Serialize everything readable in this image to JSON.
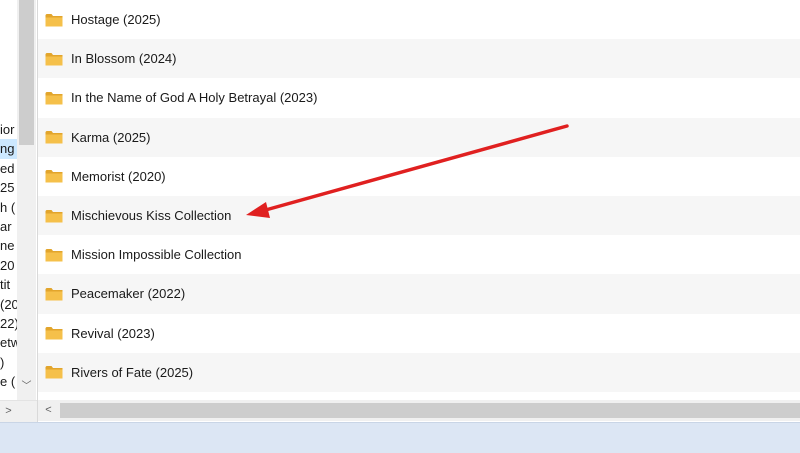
{
  "left_pane": {
    "fragments": [
      "ior",
      "ng",
      "ed",
      "25",
      "h (",
      "ar",
      "ne",
      "20",
      "tit",
      "(20",
      "22)",
      "etw",
      ")",
      "e ("
    ],
    "selected_index": 1
  },
  "folders": [
    {
      "label": "Hostage (2025)"
    },
    {
      "label": "In Blossom (2024)"
    },
    {
      "label": "In the Name of God A Holy Betrayal (2023)"
    },
    {
      "label": "Karma (2025)"
    },
    {
      "label": "Memorist (2020)"
    },
    {
      "label": "Mischievous Kiss Collection"
    },
    {
      "label": "Mission Impossible Collection"
    },
    {
      "label": "Peacemaker (2022)"
    },
    {
      "label": "Revival (2023)"
    },
    {
      "label": "Rivers of Fate (2025)"
    }
  ],
  "icons": {
    "folder": "folder-icon",
    "scroll_up": "chevron-up-icon",
    "scroll_down": "chevron-down-icon",
    "scroll_left": "chevron-left-icon",
    "scroll_right": "chevron-right-icon"
  },
  "glyphs": {
    "up": "︿",
    "down": "﹀",
    "left": "<",
    "right": ">"
  },
  "colors": {
    "alt_row": "#f6f6f6",
    "selection": "#cce8ff",
    "arrow": "#e02020",
    "folder": "#f5c04a",
    "statusbar": "#dce6f4"
  },
  "annotation": {
    "type": "arrow",
    "points_to": "Mischievous Kiss Collection"
  }
}
